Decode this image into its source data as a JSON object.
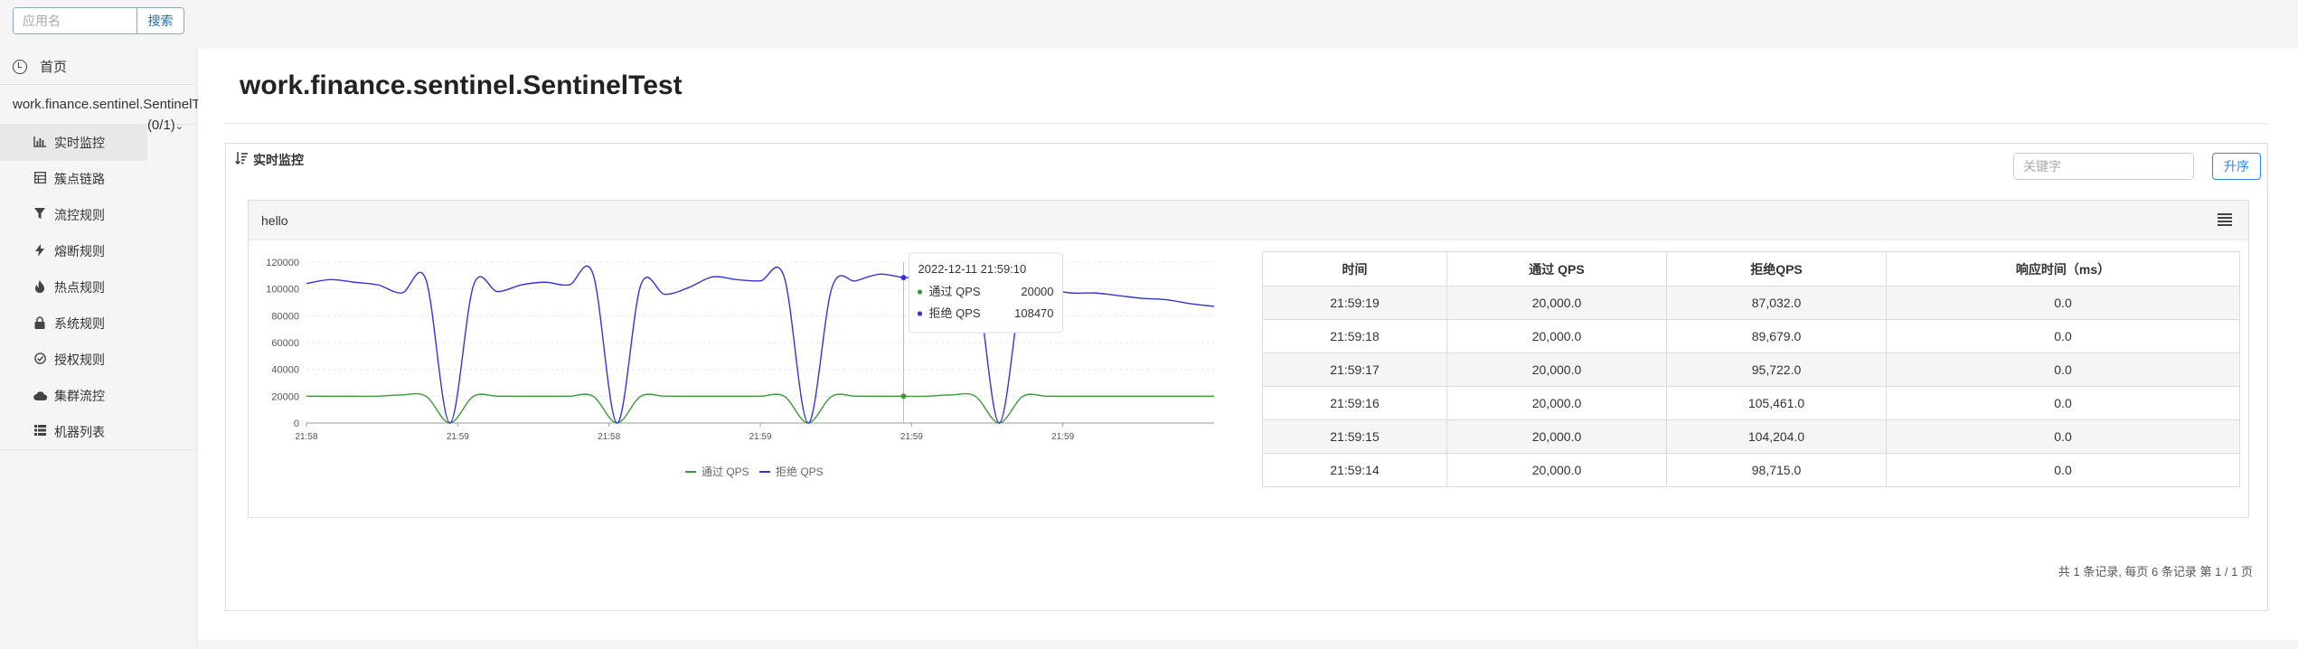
{
  "search": {
    "placeholder": "应用名",
    "button_label": "搜索"
  },
  "sidebar": {
    "home_label": "首页",
    "app_name": "work.finance.sentinel.SentinelTest",
    "app_count": "(0/1)",
    "items": [
      {
        "label": "实时监控",
        "icon": "bar-chart-icon",
        "active": true
      },
      {
        "label": "簇点链路",
        "icon": "table-icon",
        "active": false
      },
      {
        "label": "流控规则",
        "icon": "filter-icon",
        "active": false
      },
      {
        "label": "熔断规则",
        "icon": "flash-icon",
        "active": false
      },
      {
        "label": "热点规则",
        "icon": "fire-icon",
        "active": false
      },
      {
        "label": "系统规则",
        "icon": "lock-icon",
        "active": false
      },
      {
        "label": "授权规则",
        "icon": "check-circle-icon",
        "active": false
      },
      {
        "label": "集群流控",
        "icon": "cloud-icon",
        "active": false
      },
      {
        "label": "机器列表",
        "icon": "list-icon",
        "active": false
      }
    ]
  },
  "main": {
    "title": "work.finance.sentinel.SentinelTest",
    "panel_title": "实时监控",
    "keyword_placeholder": "关键字",
    "sort_button": "升序",
    "resource_name": "hello",
    "footer": "共 1 条记录, 每页 6 条记录 第 1 / 1 页"
  },
  "chart_data": {
    "type": "line",
    "x_tick_labels": [
      "21:58",
      "21:59",
      "21:58",
      "21:59",
      "21:59",
      "21:59"
    ],
    "y_ticks": [
      0,
      20000,
      40000,
      60000,
      80000,
      100000,
      120000
    ],
    "ylim": [
      0,
      120000
    ],
    "legend_position": "bottom",
    "grid": true,
    "series": [
      {
        "name": "通过 QPS",
        "color": "#3a9a3a",
        "values": [
          20000,
          20000,
          20000,
          20000,
          21000,
          20000,
          0,
          20000,
          20000,
          20000,
          20000,
          20000,
          20000,
          0,
          20000,
          20000,
          20000,
          20000,
          20000,
          20000,
          20000,
          0,
          20000,
          20000,
          20000,
          20000,
          20000,
          21000,
          20000,
          0,
          20000,
          20000,
          20000,
          20000,
          20000,
          20000,
          20000,
          20000,
          20000
        ]
      },
      {
        "name": "拒绝 QPS",
        "color": "#3434d8",
        "values": [
          104000,
          107000,
          105000,
          103000,
          97000,
          107000,
          0,
          103000,
          98000,
          103000,
          105000,
          103000,
          111000,
          0,
          103000,
          96000,
          101000,
          109000,
          107000,
          106000,
          109000,
          0,
          101000,
          106000,
          111000,
          108470,
          107000,
          86000,
          107000,
          0,
          103000,
          100000,
          97000,
          97000,
          95000,
          93000,
          92000,
          89000,
          87000
        ]
      }
    ],
    "tooltip": {
      "title": "2022-12-11 21:59:10",
      "rows": [
        {
          "name": "通过 QPS",
          "value": "20000",
          "color": "#3a9a3a"
        },
        {
          "name": "拒绝 QPS",
          "value": "108470",
          "color": "#3434d8"
        }
      ]
    }
  },
  "table": {
    "headers": [
      "时间",
      "通过 QPS",
      "拒绝QPS",
      "响应时间（ms）"
    ],
    "rows": [
      [
        "21:59:19",
        "20,000.0",
        "87,032.0",
        "0.0"
      ],
      [
        "21:59:18",
        "20,000.0",
        "89,679.0",
        "0.0"
      ],
      [
        "21:59:17",
        "20,000.0",
        "95,722.0",
        "0.0"
      ],
      [
        "21:59:16",
        "20,000.0",
        "105,461.0",
        "0.0"
      ],
      [
        "21:59:15",
        "20,000.0",
        "104,204.0",
        "0.0"
      ],
      [
        "21:59:14",
        "20,000.0",
        "98,715.0",
        "0.0"
      ]
    ]
  }
}
